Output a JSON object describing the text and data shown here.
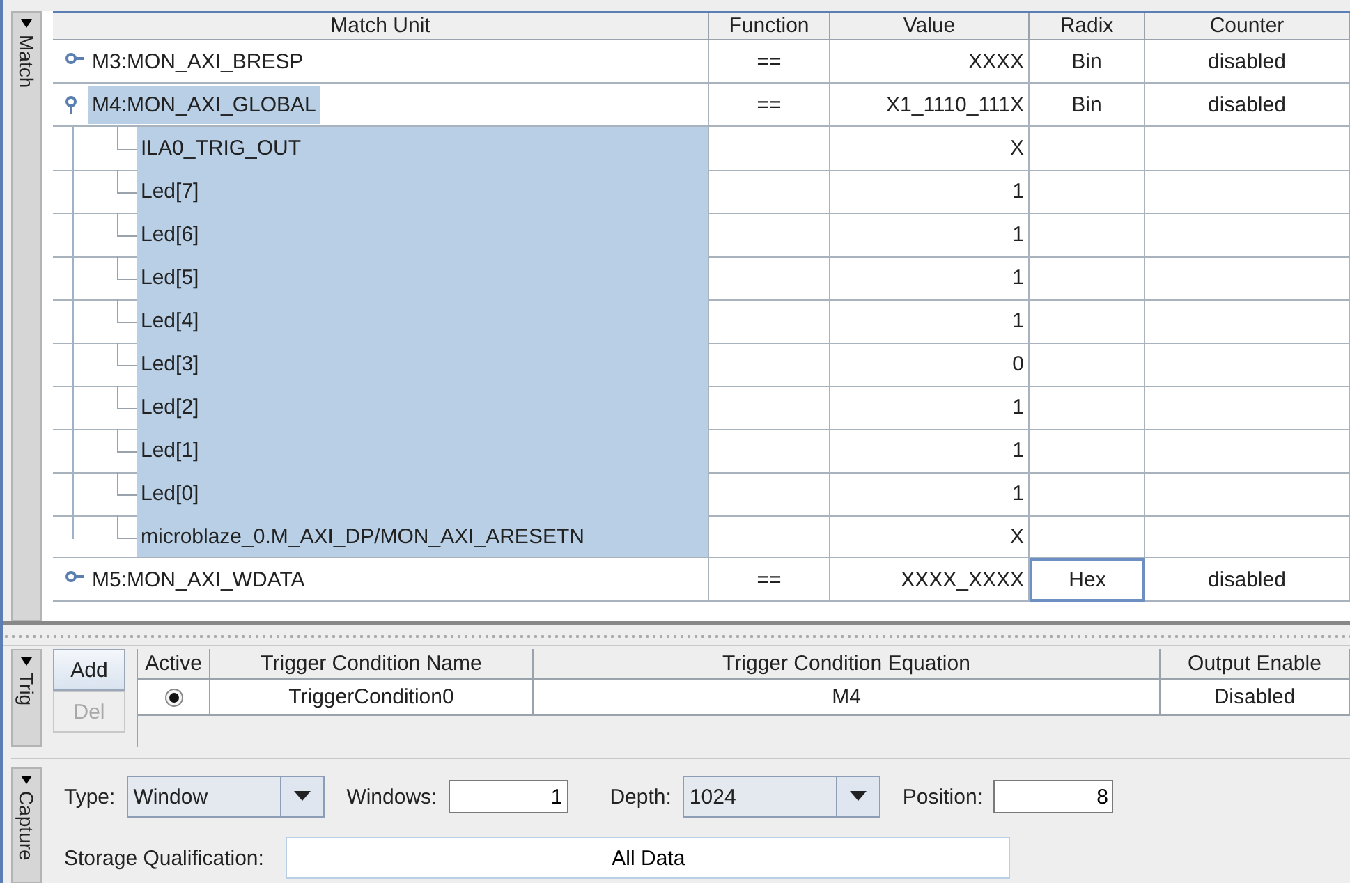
{
  "match": {
    "title": "Match",
    "expanded": true,
    "columns": [
      "Match Unit",
      "Function",
      "Value",
      "Radix",
      "Counter"
    ],
    "rows": [
      {
        "name": "M3:MON_AXI_BRESP",
        "function": "==",
        "value": "XXXX",
        "radix": "Bin",
        "counter": "disabled",
        "expanded": false,
        "selected": false,
        "radix_focused": false
      },
      {
        "name": "M4:MON_AXI_GLOBAL",
        "function": "==",
        "value": "X1_1110_111X",
        "radix": "Bin",
        "counter": "disabled",
        "expanded": true,
        "selected": true,
        "radix_focused": false,
        "children": [
          {
            "name": "ILA0_TRIG_OUT",
            "value": "X",
            "selected": true
          },
          {
            "name": "Led[7]",
            "value": "1",
            "selected": true
          },
          {
            "name": "Led[6]",
            "value": "1",
            "selected": true
          },
          {
            "name": "Led[5]",
            "value": "1",
            "selected": true
          },
          {
            "name": "Led[4]",
            "value": "1",
            "selected": true
          },
          {
            "name": "Led[3]",
            "value": "0",
            "selected": true
          },
          {
            "name": "Led[2]",
            "value": "1",
            "selected": true
          },
          {
            "name": "Led[1]",
            "value": "1",
            "selected": true
          },
          {
            "name": "Led[0]",
            "value": "1",
            "selected": true
          },
          {
            "name": "microblaze_0.M_AXI_DP/MON_AXI_ARESETN",
            "value": "X",
            "selected": true
          }
        ]
      },
      {
        "name": "M5:MON_AXI_WDATA",
        "function": "==",
        "value": "XXXX_XXXX",
        "radix": "Hex",
        "counter": "disabled",
        "expanded": false,
        "selected": false,
        "radix_focused": true
      }
    ]
  },
  "trigger": {
    "title": "Trig",
    "expanded": true,
    "buttons": [
      {
        "label": "Add",
        "disabled": false
      },
      {
        "label": "Del",
        "disabled": true
      }
    ],
    "columns": [
      "Active",
      "Trigger Condition Name",
      "Trigger Condition Equation",
      "Output Enable"
    ],
    "rows": [
      {
        "active": true,
        "name": "TriggerCondition0",
        "equation": "M4",
        "output_enable": "Disabled"
      }
    ]
  },
  "capture": {
    "title": "Capture",
    "expanded": true,
    "fields": [
      {
        "kind": "dropdown",
        "label": "Type:",
        "value": "Window"
      },
      {
        "kind": "input",
        "label": "Windows:",
        "value": "1"
      },
      {
        "kind": "dropdown",
        "label": "Depth:",
        "value": "1024"
      },
      {
        "kind": "input",
        "label": "Position:",
        "value": "8"
      }
    ],
    "storage": {
      "label": "Storage Qualification:",
      "value": "All Data"
    }
  }
}
